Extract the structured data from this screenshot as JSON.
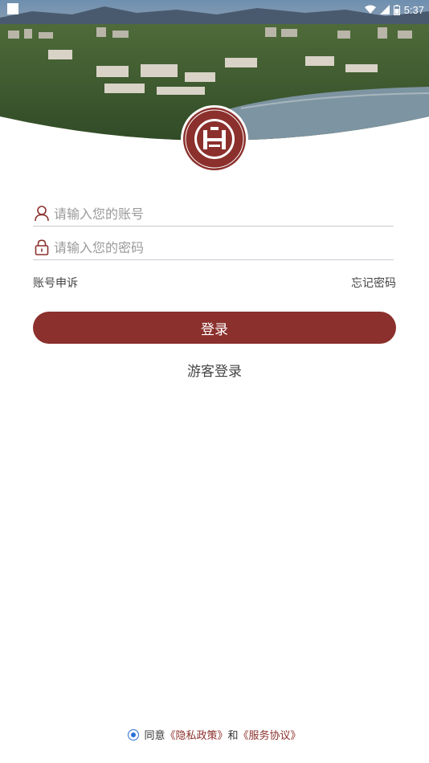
{
  "status_bar": {
    "time": "5:37"
  },
  "form": {
    "account_placeholder": "请输入您的账号",
    "password_placeholder": "请输入您的密码",
    "appeal_label": "账号申诉",
    "forgot_label": "忘记密码",
    "login_label": "登录",
    "guest_label": "游客登录"
  },
  "agreement": {
    "prefix": "同意",
    "privacy_label": "《隐私政策》",
    "conjunction": "和",
    "service_label": "《服务协议》"
  },
  "colors": {
    "brand": "#8b302c",
    "radio": "#2a6fd6",
    "divider": "#c9cbcf"
  },
  "icons": {
    "account": "user-icon",
    "password": "lock-icon",
    "wifi": "wifi-icon",
    "signal": "signal-icon",
    "battery": "battery-icon"
  }
}
